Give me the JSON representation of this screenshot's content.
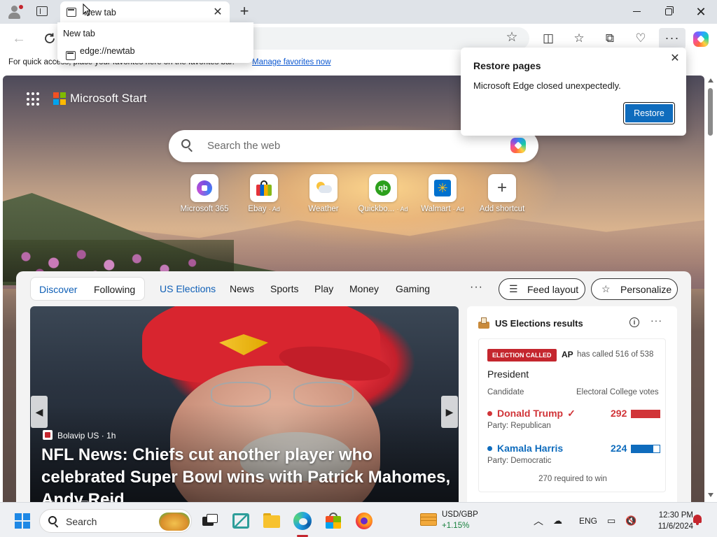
{
  "browser": {
    "tab": {
      "title": "New tab"
    },
    "tab_hover": {
      "title": "New tab",
      "url": "edge://newtab"
    },
    "favorites_bar": {
      "text": "For quick access, place your favorites here on the favorites bar.",
      "link": "Manage favorites now"
    },
    "toolbar_icons": [
      "back-icon",
      "refresh-icon",
      "star-icon",
      "split-screen-icon",
      "favorites-icon",
      "collections-icon",
      "browser-essentials-icon",
      "more-icon",
      "copilot-icon"
    ]
  },
  "restore_popup": {
    "title": "Restore pages",
    "message": "Microsoft Edge closed unexpectedly.",
    "button": "Restore"
  },
  "newtab": {
    "brand": "Microsoft Start",
    "search_placeholder": "Search the web",
    "shortcuts": [
      {
        "label": "Microsoft 365",
        "ad": "",
        "icon": "microsoft-365-icon"
      },
      {
        "label": "Ebay",
        "ad": "· Ad",
        "icon": "ebay-icon"
      },
      {
        "label": "Weather",
        "ad": "",
        "icon": "weather-icon"
      },
      {
        "label": "Quickbo...",
        "ad": "· Ad",
        "icon": "quickbooks-icon"
      },
      {
        "label": "Walmart",
        "ad": "· Ad",
        "icon": "walmart-icon"
      },
      {
        "label": "Add shortcut",
        "ad": "",
        "icon": "plus-icon"
      }
    ],
    "feed_nav": {
      "discover": "Discover",
      "following": "Following",
      "items": [
        "US Elections",
        "News",
        "Sports",
        "Play",
        "Money",
        "Gaming"
      ],
      "active": "US Elections",
      "more": "···",
      "feed_layout": "Feed layout",
      "personalize": "Personalize"
    },
    "hero": {
      "source": "Bolavip US",
      "age": "1h",
      "headline": "NFL News: Chiefs cut another player who celebrated Super Bowl wins with Patrick Mahomes, Andy Reid"
    },
    "elections": {
      "title": "US Elections results",
      "badge": "ELECTION CALLED",
      "ap": "AP",
      "ap_note": "has called 516 of 538",
      "race": "President",
      "col_candidate": "Candidate",
      "col_votes": "Electoral College votes",
      "candidates": [
        {
          "name": "Donald Trump",
          "check": "✓",
          "party": "Party: Republican",
          "votes": "292",
          "fill": 1.0,
          "color": "#d13438"
        },
        {
          "name": "Kamala Harris",
          "check": "",
          "party": "Party: Democratic",
          "votes": "224",
          "fill": 0.77,
          "color": "#0f6cbd"
        }
      ],
      "required": "270 required to win"
    }
  },
  "taskbar": {
    "search": "Search",
    "ticker_symbol": "USD/GBP",
    "ticker_change": "+1.15%",
    "language": "ENG",
    "time": "12:30 PM",
    "date": "11/6/2024"
  }
}
